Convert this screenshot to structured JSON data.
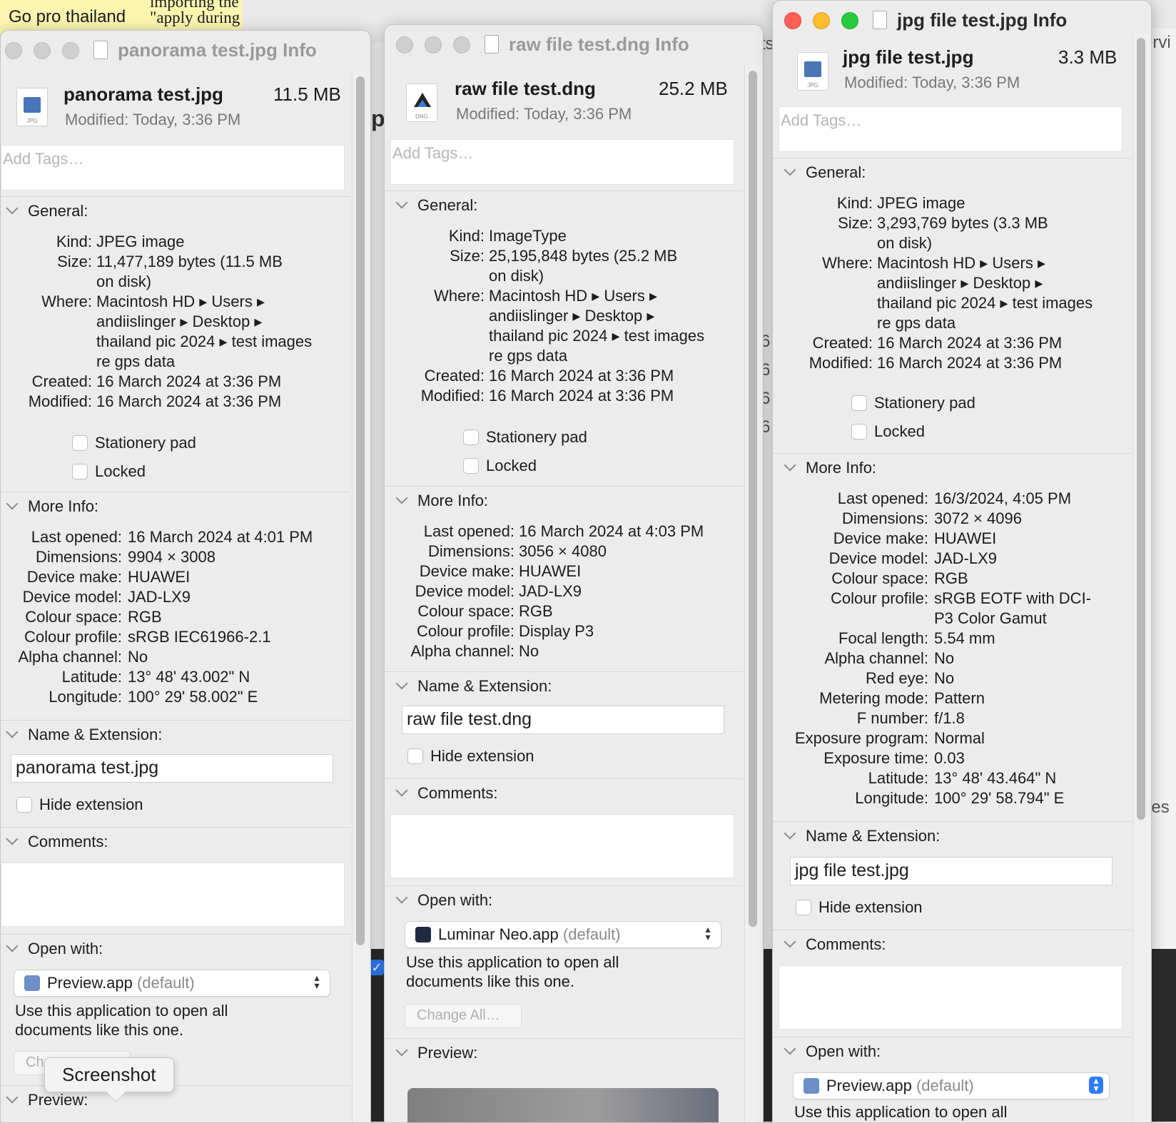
{
  "background": {
    "note1": "Go pro thailand",
    "note2_line1": "importing the",
    "note2_line2": "\"apply during",
    "frag_services": "ervi",
    "frag_ts": "ts",
    "frag_pl": "pl",
    "frag_ges": "ges",
    "frag_digit": "6"
  },
  "tooltip": {
    "label": "Screenshot"
  },
  "labels": {
    "add_tags": "Add Tags…",
    "general": "General:",
    "more_info": "More Info:",
    "name_ext": "Name & Extension:",
    "comments": "Comments:",
    "open_with": "Open with:",
    "preview": "Preview:",
    "kind": "Kind:",
    "size": "Size:",
    "where": "Where:",
    "created": "Created:",
    "modified": "Modified:",
    "stationery": "Stationery pad",
    "locked": "Locked",
    "hide_ext": "Hide extension",
    "use_app_line1": "Use this application to open all",
    "use_app_line2": "documents like this one.",
    "change_all": "Change All…",
    "default_tag": "(default)",
    "last_opened": "Last opened:",
    "dimensions": "Dimensions:",
    "device_make": "Device make:",
    "device_model": "Device model:",
    "colour_space": "Colour space:",
    "colour_profile": "Colour profile:",
    "alpha_channel": "Alpha channel:",
    "latitude": "Latitude:",
    "longitude": "Longitude:",
    "focal_length": "Focal length:",
    "red_eye": "Red eye:",
    "metering_mode": "Metering mode:",
    "f_number": "F number:",
    "exposure_program": "Exposure program:",
    "exposure_time": "Exposure time:"
  },
  "win1": {
    "title": "panorama test.jpg Info",
    "filename": "panorama test.jpg",
    "filesize": "11.5 MB",
    "modified_line": "Modified:  Today, 3:36 PM",
    "icon_ext": "JPG",
    "kind": "JPEG image",
    "size_1": "11,477,189 bytes (11.5 MB",
    "size_2": "on disk)",
    "where_1": "Macintosh HD ▸ Users ▸",
    "where_2": "andiislinger ▸ Desktop ▸",
    "where_3": "thailand pic 2024 ▸ test images",
    "where_4": "re gps data",
    "created": "16 March 2024 at 3:36 PM",
    "modified": "16 March 2024 at 3:36 PM",
    "last_opened": "16 March 2024 at 4:01 PM",
    "dimensions": "9904 × 3008",
    "device_make": "HUAWEI",
    "device_model": "JAD-LX9",
    "colour_space": "RGB",
    "colour_profile": "sRGB IEC61966-2.1",
    "alpha_channel": "No",
    "latitude": "13° 48' 43.002\" N",
    "longitude": "100° 29' 58.002\" E",
    "name_field": "panorama test.jpg",
    "open_with_app": "Preview.app",
    "change_all_partial": "Ch"
  },
  "win2": {
    "title": "raw file test.dng Info",
    "filename": "raw file test.dng",
    "filesize": "25.2 MB",
    "modified_line": "Modified:  Today, 3:36 PM",
    "icon_ext": "DNG",
    "kind": "ImageType",
    "size_1": "25,195,848 bytes (25.2 MB",
    "size_2": "on disk)",
    "where_1": "Macintosh HD ▸ Users ▸",
    "where_2": "andiislinger ▸ Desktop ▸",
    "where_3": "thailand pic 2024 ▸ test images",
    "where_4": "re gps data",
    "created": "16 March 2024 at 3:36 PM",
    "modified": "16 March 2024 at 3:36 PM",
    "last_opened": "16 March 2024 at 4:03 PM",
    "dimensions": "3056 × 4080",
    "device_make": "HUAWEI",
    "device_model": "JAD-LX9",
    "colour_space": "RGB",
    "colour_profile": "Display P3",
    "alpha_channel": "No",
    "name_field": "raw file test.dng",
    "open_with_app": "Luminar Neo.app"
  },
  "win3": {
    "title": "jpg file test.jpg Info",
    "filename": "jpg file test.jpg",
    "filesize": "3.3 MB",
    "modified_line": "Modified:  Today, 3:36 PM",
    "icon_ext": "JPG",
    "kind": "JPEG image",
    "size_1": "3,293,769 bytes (3.3 MB",
    "size_2": "on disk)",
    "where_1": "Macintosh HD ▸ Users ▸",
    "where_2": "andiislinger ▸ Desktop ▸",
    "where_3": "thailand pic 2024 ▸ test images",
    "where_4": "re gps data",
    "created": "16 March 2024 at 3:36 PM",
    "modified": "16 March 2024 at 3:36 PM",
    "last_opened": "16/3/2024, 4:05 PM",
    "dimensions": "3072 × 4096",
    "device_make": "HUAWEI",
    "device_model": "JAD-LX9",
    "colour_space": "RGB",
    "colour_profile_1": "sRGB EOTF with DCI-",
    "colour_profile_2": "P3 Color Gamut",
    "focal_length": "5.54 mm",
    "alpha_channel": "No",
    "red_eye": "No",
    "metering_mode": "Pattern",
    "f_number": "f/1.8",
    "exposure_program": "Normal",
    "exposure_time": "0.03",
    "latitude": "13° 48' 43.464\" N",
    "longitude": "100° 29' 58.794\" E",
    "name_field": "jpg file test.jpg",
    "open_with_app": "Preview.app"
  },
  "colors": {
    "close": "#fe5f57",
    "minimize": "#febc2e",
    "zoom": "#28c840",
    "accent": "#2f7cf6"
  },
  "icons": {
    "traffic_lights": [
      "close-icon",
      "minimize-icon",
      "zoom-icon"
    ],
    "disclosure": "chevron-down-icon",
    "popup_arrows": "updown-arrows-icon"
  }
}
